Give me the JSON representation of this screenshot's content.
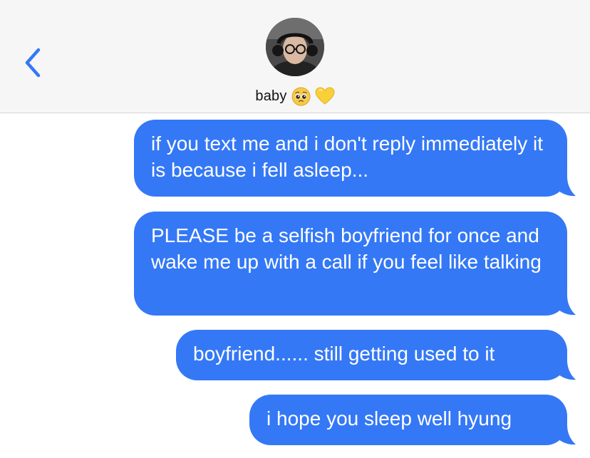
{
  "header": {
    "back_icon": "chevron-left-icon",
    "contact_name": "baby",
    "contact_emojis": [
      "pleading-face-emoji",
      "yellow-heart-emoji"
    ],
    "accent_color": "#3478f6"
  },
  "messages": [
    {
      "sender": "me",
      "text": "if you text me and i don't reply immediately it is because i fell asleep..."
    },
    {
      "sender": "me",
      "text": "PLEASE be a selfish boyfriend for once and wake me up with a call if you feel like talking"
    },
    {
      "sender": "me",
      "text": "boyfriend...... still getting used to it"
    },
    {
      "sender": "me",
      "text": "i hope you sleep well hyung"
    }
  ],
  "colors": {
    "bubble": "#3478f6",
    "header_bg": "#f6f6f6",
    "page_bg": "#ffffff"
  }
}
